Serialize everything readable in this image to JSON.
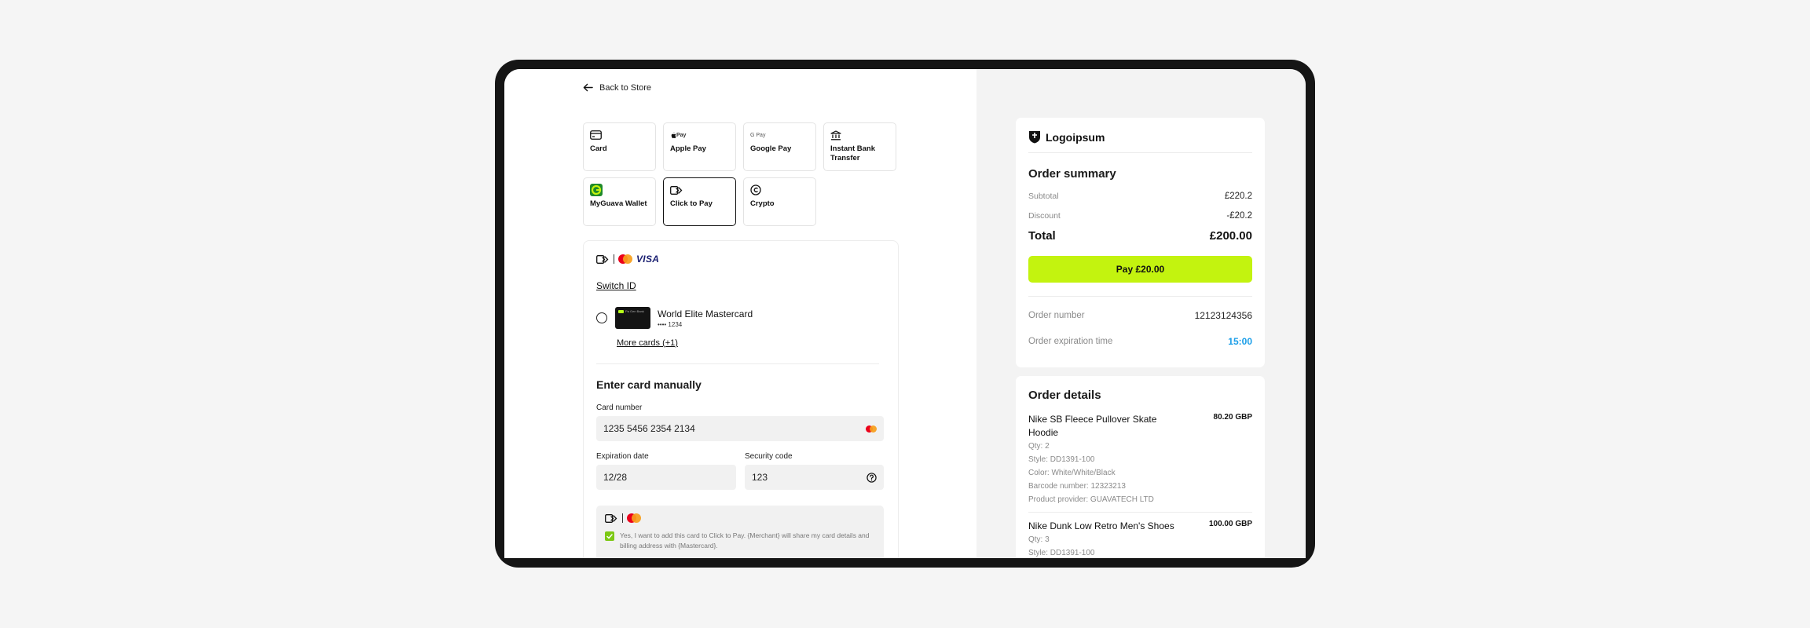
{
  "back_label": "Back to Store",
  "methods": [
    {
      "label": "Card",
      "icon": "card-icon"
    },
    {
      "label": "Apple Pay",
      "icon": "apple-pay-icon",
      "mark": "Pay"
    },
    {
      "label": "Google Pay",
      "icon": "google-pay-icon",
      "mark": "G Pay"
    },
    {
      "label": "Instant Bank Transfer",
      "icon": "bank-icon"
    },
    {
      "label": "MyGuava Wallet",
      "icon": "guava-wallet-icon"
    },
    {
      "label": "Click to Pay",
      "icon": "click-to-pay-icon",
      "active": true
    },
    {
      "label": "Crypto",
      "icon": "crypto-icon"
    }
  ],
  "c2p": {
    "visa": "VISA",
    "switch_id": "Switch ID",
    "saved_card": {
      "name": "World Elite Mastercard",
      "number": "•••• 1234",
      "bank": "Pa Gen Bank"
    },
    "more_cards": "More cards (+1)"
  },
  "manual": {
    "title": "Enter card manually",
    "card_number_label": "Card number",
    "card_number": "1235 5456 2354 2134",
    "exp_label": "Expiration date",
    "exp": "12/28",
    "cvc_label": "Security code",
    "cvc": "123",
    "consent": "Yes, I want to add this card to Click to Pay. {Merchant} will share my card details and billing address with {Mastercard}."
  },
  "summary": {
    "brand": "Logoipsum",
    "title": "Order summary",
    "subtotal_label": "Subtotal",
    "subtotal": "£220.2",
    "discount_label": "Discount",
    "discount": "-£20.2",
    "total_label": "Total",
    "total": "£200.00",
    "pay_label": "Pay £20.00",
    "order_number_label": "Order number",
    "order_number": "12123124356",
    "expiration_label": "Order expiration time",
    "expiration": "15:00"
  },
  "details": {
    "title": "Order details",
    "items": [
      {
        "name": "Nike SB Fleece Pullover Skate Hoodie",
        "price": "80.20 GBP",
        "qty": "Qty: 2",
        "style": "Style: DD1391-100",
        "color": "Color: White/White/Black",
        "barcode": "Barcode number: 12323213",
        "provider": "Product provider: GUAVATECH LTD"
      },
      {
        "name": "Nike Dunk Low Retro Men's Shoes",
        "price": "100.00 GBP",
        "qty": "Qty: 3",
        "style": "Style: DD1391-100"
      }
    ]
  },
  "colors": {
    "accent": "#c3f30f",
    "timer": "#1a9ee8",
    "check": "#7cc814"
  }
}
